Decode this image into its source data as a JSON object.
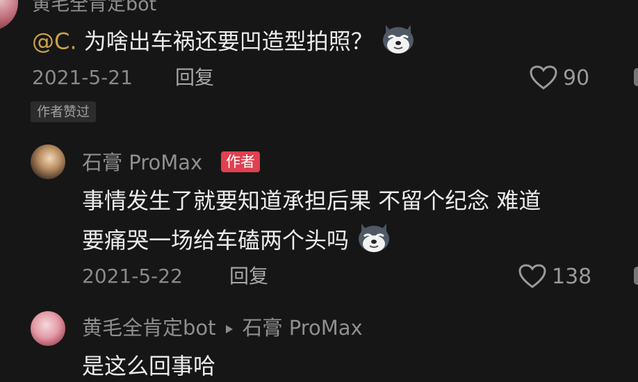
{
  "comment1": {
    "username": "黄毛全肯定bot",
    "mention": "@C.",
    "text": " 为啥出车祸还要凹造型拍照？",
    "date": "2021-5-21",
    "reply_label": "回复",
    "likes": "90",
    "liked_badge": "作者赞过",
    "emoji": "husky-emoji"
  },
  "reply1": {
    "username": "石膏 ProMax",
    "author_tag": "作者",
    "line1": "事情发生了就要知道承担后果 不留个纪念 难道",
    "line2": "要痛哭一场给车磕两个头吗",
    "date": "2021-5-22",
    "reply_label": "回复",
    "likes": "138",
    "emoji": "husky-emoji"
  },
  "reply2": {
    "username": "黄毛全肯定bot",
    "reply_to": "石膏 ProMax",
    "text": "是这么回事哈"
  },
  "colors": {
    "background": "#161616",
    "mention": "#c9a24a",
    "author_tag": "#e0404f"
  }
}
